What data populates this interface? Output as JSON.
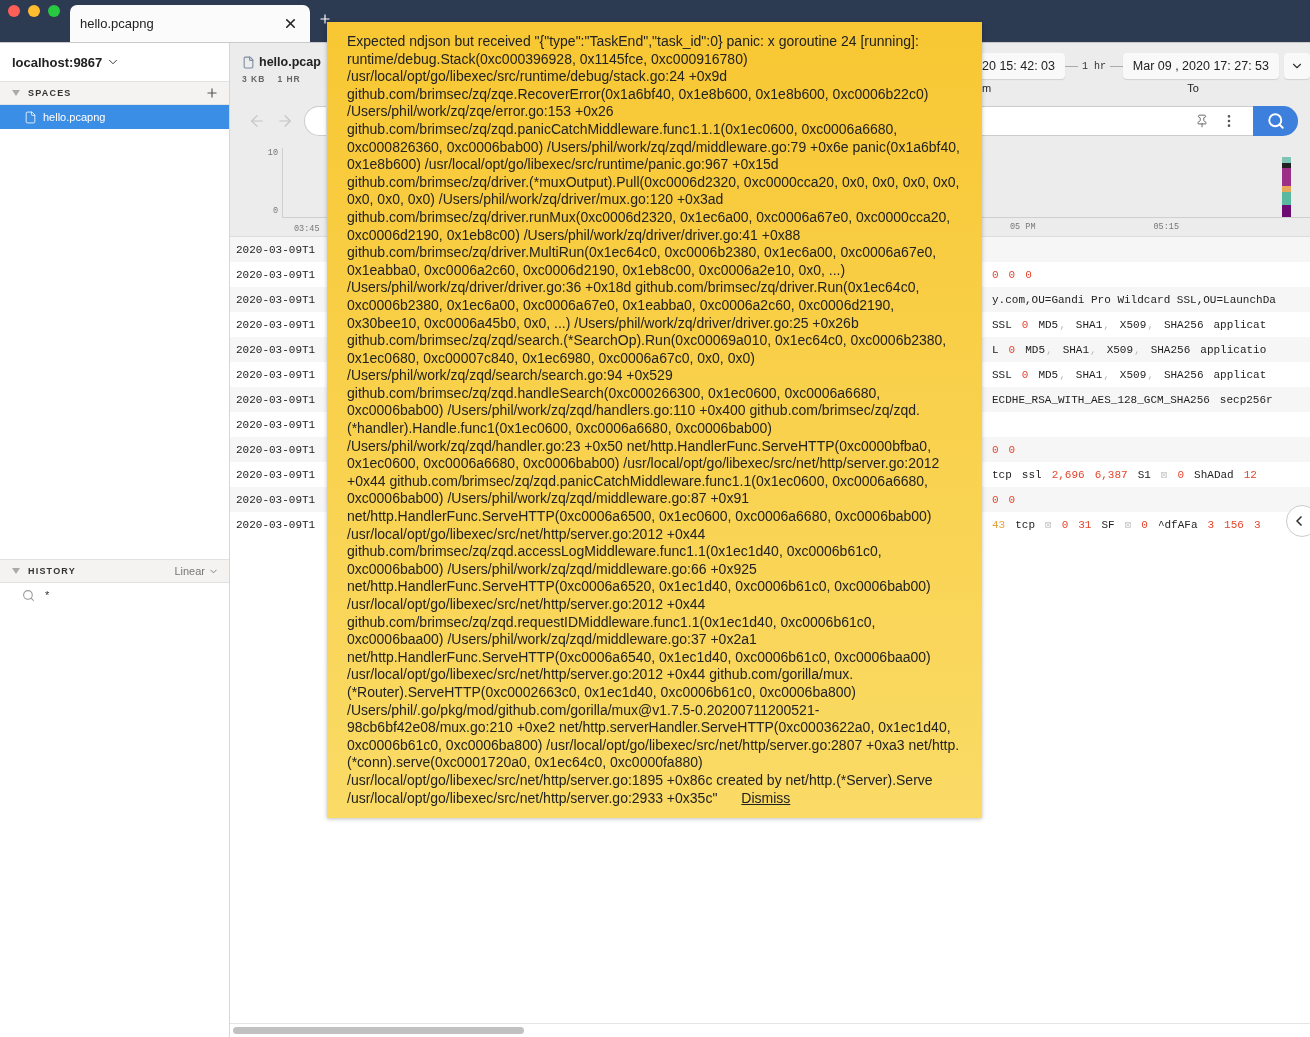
{
  "window": {
    "tab": {
      "title": "hello.pcapng",
      "selected": true
    }
  },
  "sidebar": {
    "workspace": "localhost:9867",
    "spaces": {
      "title": "SPACES",
      "expanded": true,
      "items": [
        {
          "label": "hello.pcapng",
          "selected": true
        }
      ]
    },
    "history": {
      "title": "HISTORY",
      "expanded": true,
      "mode": "Linear",
      "items": [
        {
          "label": "*"
        }
      ]
    }
  },
  "header": {
    "file_name": "hello.pcap",
    "size": "3 KB",
    "duration": "1 HR",
    "from_value": "20 15: 42: 03",
    "from_label": "m",
    "span": "1 hr",
    "to_value": "Mar 09 , 2020 17: 27: 53",
    "to_label": "To"
  },
  "chart": {
    "y_ticks": [
      "10",
      "0"
    ],
    "left_x_ticks": [
      "03:45"
    ],
    "right_x_ticks": [
      "05 PM",
      "05:15"
    ]
  },
  "log": {
    "records": [
      {
        "time": "2020-03-09T1"
      },
      {
        "time": "2020-03-09T1",
        "cells": [
          {
            "text": "0",
            "kind": "number"
          },
          {
            "text": "0",
            "kind": "number"
          },
          {
            "text": "0",
            "kind": "number"
          }
        ]
      },
      {
        "time": "2020-03-09T1",
        "cells": [
          {
            "text": "y.com,OU=Gandi Pro Wildcard SSL,OU=LaunchDa",
            "kind": "plain"
          }
        ]
      },
      {
        "time": "2020-03-09T1",
        "cells": [
          {
            "text": "SSL",
            "kind": "plain"
          },
          {
            "text": "0",
            "kind": "number"
          },
          {
            "text": "MD5",
            "kind": "plain"
          },
          {
            "text": ",",
            "kind": "sep"
          },
          {
            "text": "SHA1",
            "kind": "plain"
          },
          {
            "text": ",",
            "kind": "sep"
          },
          {
            "text": "X509",
            "kind": "plain"
          },
          {
            "text": ",",
            "kind": "sep"
          },
          {
            "text": "SHA256",
            "kind": "plain"
          },
          {
            "text": "applicat",
            "kind": "plain"
          }
        ]
      },
      {
        "time": "2020-03-09T1",
        "cells": [
          {
            "text": "L",
            "kind": "plain"
          },
          {
            "text": "0",
            "kind": "number"
          },
          {
            "text": "MD5",
            "kind": "plain"
          },
          {
            "text": ",",
            "kind": "sep"
          },
          {
            "text": "SHA1",
            "kind": "plain"
          },
          {
            "text": ",",
            "kind": "sep"
          },
          {
            "text": "X509",
            "kind": "plain"
          },
          {
            "text": ",",
            "kind": "sep"
          },
          {
            "text": "SHA256",
            "kind": "plain"
          },
          {
            "text": "applicatio",
            "kind": "plain"
          }
        ]
      },
      {
        "time": "2020-03-09T1",
        "cells": [
          {
            "text": "SSL",
            "kind": "plain"
          },
          {
            "text": "0",
            "kind": "number"
          },
          {
            "text": "MD5",
            "kind": "plain"
          },
          {
            "text": ",",
            "kind": "sep"
          },
          {
            "text": "SHA1",
            "kind": "plain"
          },
          {
            "text": ",",
            "kind": "sep"
          },
          {
            "text": "X509",
            "kind": "plain"
          },
          {
            "text": ",",
            "kind": "sep"
          },
          {
            "text": "SHA256",
            "kind": "plain"
          },
          {
            "text": "applicat",
            "kind": "plain"
          }
        ]
      },
      {
        "time": "2020-03-09T1",
        "cells": [
          {
            "text": "ECDHE_RSA_WITH_AES_128_GCM_SHA256",
            "kind": "plain"
          },
          {
            "text": "secp256r",
            "kind": "plain"
          }
        ]
      },
      {
        "time": "2020-03-09T1"
      },
      {
        "time": "2020-03-09T1",
        "cells": [
          {
            "text": "0",
            "kind": "number"
          },
          {
            "text": "0",
            "kind": "number"
          }
        ]
      },
      {
        "time": "2020-03-09T1",
        "cells": [
          {
            "text": "tcp",
            "kind": "plain"
          },
          {
            "text": "ssl",
            "kind": "plain"
          },
          {
            "text": "2,696",
            "kind": "number"
          },
          {
            "text": "6,387",
            "kind": "number"
          },
          {
            "text": "S1",
            "kind": "plain"
          },
          {
            "text": "⊠",
            "kind": "null"
          },
          {
            "text": "0",
            "kind": "number"
          },
          {
            "text": "ShADad",
            "kind": "plain"
          },
          {
            "text": "12",
            "kind": "number"
          }
        ]
      },
      {
        "time": "2020-03-09T1",
        "cells": [
          {
            "text": "0",
            "kind": "number"
          },
          {
            "text": "0",
            "kind": "number"
          }
        ]
      },
      {
        "time": "2020-03-09T1",
        "cells": [
          {
            "text": "43",
            "kind": "port"
          },
          {
            "text": "tcp",
            "kind": "plain"
          },
          {
            "text": "⊠",
            "kind": "null"
          },
          {
            "text": "0",
            "kind": "number"
          },
          {
            "text": "31",
            "kind": "number"
          },
          {
            "text": "SF",
            "kind": "plain"
          },
          {
            "text": "⊠",
            "kind": "null"
          },
          {
            "text": "0",
            "kind": "number"
          },
          {
            "text": "^dfAFa",
            "kind": "plain"
          },
          {
            "text": "3",
            "kind": "number"
          },
          {
            "text": "156",
            "kind": "number"
          },
          {
            "text": "3",
            "kind": "number"
          }
        ]
      }
    ]
  },
  "notice": {
    "message": "Expected ndjson but received \"{\"type\":\"TaskEnd\",\"task_id\":0} panic: x goroutine 24 [running]: runtime/debug.Stack(0xc000396928, 0x1145fce, 0xc000916780) /usr/local/opt/go/libexec/src/runtime/debug/stack.go:24 +0x9d github.com/brimsec/zq/zqe.RecoverError(0x1a6bf40, 0x1e8b600, 0x1e8b600, 0xc0006b22c0) /Users/phil/work/zq/zqe/error.go:153 +0x26 github.com/brimsec/zq/zqd.panicCatchMiddleware.func1.1.1(0x1ec0600, 0xc0006a6680, 0xc000826360, 0xc0006bab00) /Users/phil/work/zq/zqd/middleware.go:79 +0x6e panic(0x1a6bf40, 0x1e8b600) /usr/local/opt/go/libexec/src/runtime/panic.go:967 +0x15d github.com/brimsec/zq/driver.(*muxOutput).Pull(0xc0006d2320, 0xc0000cca20, 0x0, 0x0, 0x0, 0x0, 0x0, 0x0, 0x0) /Users/phil/work/zq/driver/mux.go:120 +0x3ad github.com/brimsec/zq/driver.runMux(0xc0006d2320, 0x1ec6a00, 0xc0006a67e0, 0xc0000cca20, 0xc0006d2190, 0x1eb8c00) /Users/phil/work/zq/driver/driver.go:41 +0x88 github.com/brimsec/zq/driver.MultiRun(0x1ec64c0, 0xc0006b2380, 0x1ec6a00, 0xc0006a67e0, 0x1eabba0, 0xc0006a2c60, 0xc0006d2190, 0x1eb8c00, 0xc0006a2e10, 0x0, ...) /Users/phil/work/zq/driver/driver.go:36 +0x18d github.com/brimsec/zq/driver.Run(0x1ec64c0, 0xc0006b2380, 0x1ec6a00, 0xc0006a67e0, 0x1eabba0, 0xc0006a2c60, 0xc0006d2190, 0x30bee10, 0xc0006a45b0, 0x0, ...) /Users/phil/work/zq/driver/driver.go:25 +0x26b github.com/brimsec/zq/zqd/search.(*SearchOp).Run(0xc00069a010, 0x1ec64c0, 0xc0006b2380, 0x1ec0680, 0xc00007c840, 0x1ec6980, 0xc0006a67c0, 0x0, 0x0) /Users/phil/work/zq/zqd/search/search.go:94 +0x529 github.com/brimsec/zq/zqd.handleSearch(0xc000266300, 0x1ec0600, 0xc0006a6680, 0xc0006bab00) /Users/phil/work/zq/zqd/handlers.go:110 +0x400 github.com/brimsec/zq/zqd.(*handler).Handle.func1(0x1ec0600, 0xc0006a6680, 0xc0006bab00) /Users/phil/work/zq/zqd/handler.go:23 +0x50 net/http.HandlerFunc.ServeHTTP(0xc0000bfba0, 0x1ec0600, 0xc0006a6680, 0xc0006bab00) /usr/local/opt/go/libexec/src/net/http/server.go:2012 +0x44 github.com/brimsec/zq/zqd.panicCatchMiddleware.func1.1(0x1ec0600, 0xc0006a6680, 0xc0006bab00) /Users/phil/work/zq/zqd/middleware.go:87 +0x91 net/http.HandlerFunc.ServeHTTP(0xc0006a6500, 0x1ec0600, 0xc0006a6680, 0xc0006bab00) /usr/local/opt/go/libexec/src/net/http/server.go:2012 +0x44 github.com/brimsec/zq/zqd.accessLogMiddleware.func1.1(0x1ec1d40, 0xc0006b61c0, 0xc0006bab00) /Users/phil/work/zq/zqd/middleware.go:66 +0x925 net/http.HandlerFunc.ServeHTTP(0xc0006a6520, 0x1ec1d40, 0xc0006b61c0, 0xc0006bab00) /usr/local/opt/go/libexec/src/net/http/server.go:2012 +0x44 github.com/brimsec/zq/zqd.requestIDMiddleware.func1.1(0x1ec1d40, 0xc0006b61c0, 0xc0006baa00) /Users/phil/work/zq/zqd/middleware.go:37 +0x2a1 net/http.HandlerFunc.ServeHTTP(0xc0006a6540, 0x1ec1d40, 0xc0006b61c0, 0xc0006baa00) /usr/local/opt/go/libexec/src/net/http/server.go:2012 +0x44 github.com/gorilla/mux.(*Router).ServeHTTP(0xc0002663c0, 0x1ec1d40, 0xc0006b61c0, 0xc0006ba800) /Users/phil/.go/pkg/mod/github.com/gorilla/mux@v1.7.5-0.20200711200521-98cb6bf42e08/mux.go:210 +0xe2 net/http.serverHandler.ServeHTTP(0xc0003622a0, 0x1ec1d40, 0xc0006b61c0, 0xc0006ba800) /usr/local/opt/go/libexec/src/net/http/server.go:2807 +0xa3 net/http.(*conn).serve(0xc0001720a0, 0x1ec64c0, 0xc0000fa880) /usr/local/opt/go/libexec/src/net/http/server.go:1895 +0x86c created by net/http.(*Server).Serve /usr/local/opt/go/libexec/src/net/http/server.go:2933 +0x35c\"",
    "action": "Dismiss"
  }
}
